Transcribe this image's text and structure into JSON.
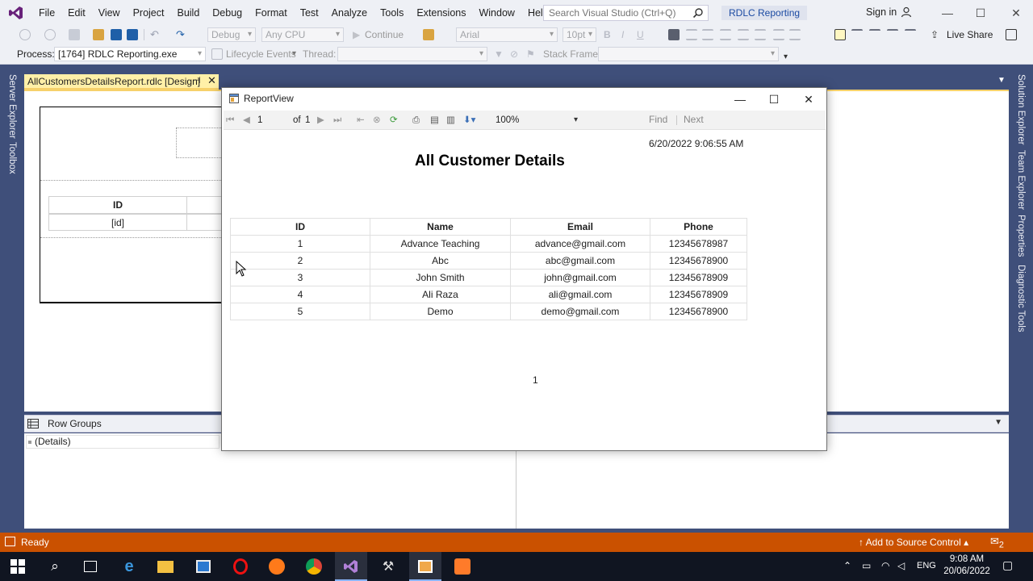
{
  "menubar": {
    "items": [
      "File",
      "Edit",
      "View",
      "Project",
      "Build",
      "Debug",
      "Format",
      "Test",
      "Analyze",
      "Tools",
      "Extensions",
      "Window",
      "Help"
    ],
    "search_placeholder": "Search Visual Studio (Ctrl+Q)",
    "solution_name": "RDLC Reporting",
    "signin": "Sign in"
  },
  "toolbar1": {
    "config": "Debug",
    "platform": "Any CPU",
    "continue": "Continue",
    "font": "Arial",
    "font_size": "10pt",
    "live_share": "Live Share"
  },
  "toolbar2": {
    "process_label": "Process:",
    "process_value": "[1764] RDLC Reporting.exe",
    "lifecycle": "Lifecycle Events",
    "thread_label": "Thread:",
    "stack_label": "Stack Frame:"
  },
  "side": {
    "left": [
      "Server Explorer",
      "Toolbox"
    ],
    "right": [
      "Solution Explorer",
      "Team Explorer",
      "Properties",
      "Diagnostic Tools"
    ]
  },
  "doc_tab": {
    "label": "AllCustomersDetailsReport.rdlc [Design]",
    "pin": "⊣",
    "close": "✕"
  },
  "designer": {
    "header_cell": "ID",
    "data_cell": "[id]"
  },
  "grouping": {
    "title": "Row Groups",
    "details": "(Details)"
  },
  "statusbar": {
    "text": "Ready",
    "source_control": "Add to Source Control",
    "notifications": "2"
  },
  "taskbar": {
    "language": "ENG",
    "time": "9:08 AM",
    "date": "20/06/2022"
  },
  "report_viewer": {
    "window_title": "ReportView",
    "page_current": "1",
    "page_of": "of",
    "page_total": "1",
    "zoom": "100%",
    "find": "Find",
    "next": "Next",
    "timestamp": "6/20/2022 9:06:55 AM",
    "report_title": "All Customer Details",
    "columns": [
      "ID",
      "Name",
      "Email",
      "Phone"
    ],
    "rows": [
      [
        "1",
        "Advance Teaching",
        "advance@gmail.com",
        "12345678987"
      ],
      [
        "2",
        "Abc",
        "abc@gmail.com",
        "12345678900"
      ],
      [
        "3",
        "John Smith",
        "john@gmail.com",
        "12345678909"
      ],
      [
        "4",
        "Ali Raza",
        "ali@gmail.com",
        "12345678909"
      ],
      [
        "5",
        "Demo",
        "demo@gmail.com",
        "12345678900"
      ]
    ],
    "page_number": "1"
  },
  "colors": {
    "vs_frame": "#3f4f7a",
    "status_orange": "#ca5100",
    "tab_yellow": "#fff0a8",
    "chrome": "#eef0f5"
  },
  "icons": {
    "vs_logo": "visual-studio-logo-icon",
    "search": "search-icon",
    "user": "user-icon"
  }
}
